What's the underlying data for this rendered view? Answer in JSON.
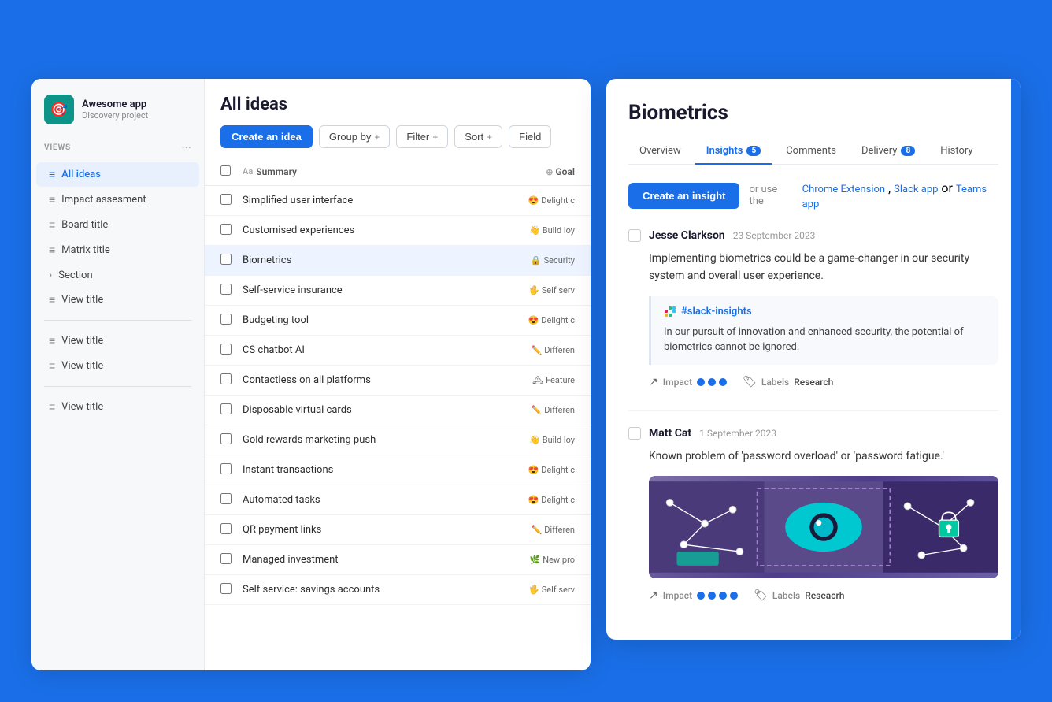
{
  "app": {
    "name": "Awesome app",
    "subtitle": "Discovery project",
    "icon": "🎯"
  },
  "sidebar": {
    "views_label": "VIEWS",
    "items": [
      {
        "id": "all-ideas",
        "label": "All ideas",
        "active": true,
        "icon": "≡"
      },
      {
        "id": "impact-assessment",
        "label": "Impact assesment",
        "active": false,
        "icon": "≡"
      },
      {
        "id": "board-title",
        "label": "Board title",
        "active": false,
        "icon": "≡"
      },
      {
        "id": "matrix-title",
        "label": "Matrix title",
        "active": false,
        "icon": "≡"
      },
      {
        "id": "section",
        "label": "Section",
        "active": false,
        "icon": "›",
        "chevron": true
      },
      {
        "id": "view-title-1",
        "label": "View title",
        "active": false,
        "icon": "≡"
      }
    ],
    "items2": [
      {
        "id": "view-title-2",
        "label": "View title",
        "active": false,
        "icon": "≡"
      },
      {
        "id": "view-title-3",
        "label": "View title",
        "active": false,
        "icon": "≡"
      }
    ],
    "items3": [
      {
        "id": "view-title-4",
        "label": "View title",
        "active": false,
        "icon": "≡"
      }
    ]
  },
  "ideas": {
    "title": "All ideas",
    "toolbar": {
      "create_label": "Create an idea",
      "group_by_label": "Group by",
      "filter_label": "Filter",
      "sort_label": "Sort",
      "fields_label": "Field"
    },
    "table": {
      "col_summary": "Summary",
      "col_goal": "Goal",
      "rows": [
        {
          "summary": "Simplified user interface",
          "goal": "😍 Delight c",
          "emoji": "😍"
        },
        {
          "summary": "Customised experiences",
          "goal": "👋 Build loy",
          "emoji": "👋"
        },
        {
          "summary": "Biometrics",
          "goal": "🔒 Security",
          "emoji": "🔒",
          "highlighted": true
        },
        {
          "summary": "Self-service insurance",
          "goal": "🖐 Self serv",
          "emoji": "🖐"
        },
        {
          "summary": "Budgeting tool",
          "goal": "😍 Delight c",
          "emoji": "😍"
        },
        {
          "summary": "CS chatbot AI",
          "goal": "✏️ Differen",
          "emoji": "✏️"
        },
        {
          "summary": "Contactless on all platforms",
          "goal": "🏔 Feature",
          "emoji": "🏔"
        },
        {
          "summary": "Disposable virtual cards",
          "goal": "✏️ Differen",
          "emoji": "✏️"
        },
        {
          "summary": "Gold rewards marketing push",
          "goal": "👋 Build loy",
          "emoji": "👋"
        },
        {
          "summary": "Instant transactions",
          "goal": "😍 Delight c",
          "emoji": "😍"
        },
        {
          "summary": "Automated tasks",
          "goal": "😍 Delight c",
          "emoji": "😍"
        },
        {
          "summary": "QR payment links",
          "goal": "✏️ Differen",
          "emoji": "✏️"
        },
        {
          "summary": "Managed investment",
          "goal": "🌿 New pro",
          "emoji": "🌿"
        },
        {
          "summary": "Self service: savings accounts",
          "goal": "🖐 Self serv",
          "emoji": "🖐"
        }
      ]
    }
  },
  "detail": {
    "title": "Biometrics",
    "tabs": [
      {
        "id": "overview",
        "label": "Overview",
        "active": false,
        "badge": null
      },
      {
        "id": "insights",
        "label": "Insights",
        "active": true,
        "badge": "5"
      },
      {
        "id": "comments",
        "label": "Comments",
        "active": false,
        "badge": null
      },
      {
        "id": "delivery",
        "label": "Delivery",
        "active": false,
        "badge": "8"
      },
      {
        "id": "history",
        "label": "History",
        "active": false,
        "badge": null
      }
    ],
    "insight_section": {
      "create_label": "Create an insight",
      "or_text": "or use the",
      "chrome_link": "Chrome Extension",
      "slack_link": "Slack app",
      "teams_link": "Teams app",
      "or2": "or"
    },
    "insights": [
      {
        "author": "Jesse Clarkson",
        "date": "23 September 2023",
        "text": "Implementing biometrics could be a game-changer in our security system and overall user experience.",
        "slack_channel": "#slack-insights",
        "slack_text": "In our pursuit of innovation and enhanced security, the potential of biometrics cannot be ignored.",
        "impact_dots": 3,
        "labels": "Research"
      },
      {
        "author": "Matt Cat",
        "date": "1 September 2023",
        "text": "Known problem of 'password overload' or 'password fatigue.'",
        "has_image": true,
        "impact_dots": 4,
        "labels": "Reseacrh"
      }
    ],
    "impact_label": "Impact",
    "labels_label": "Labels"
  }
}
